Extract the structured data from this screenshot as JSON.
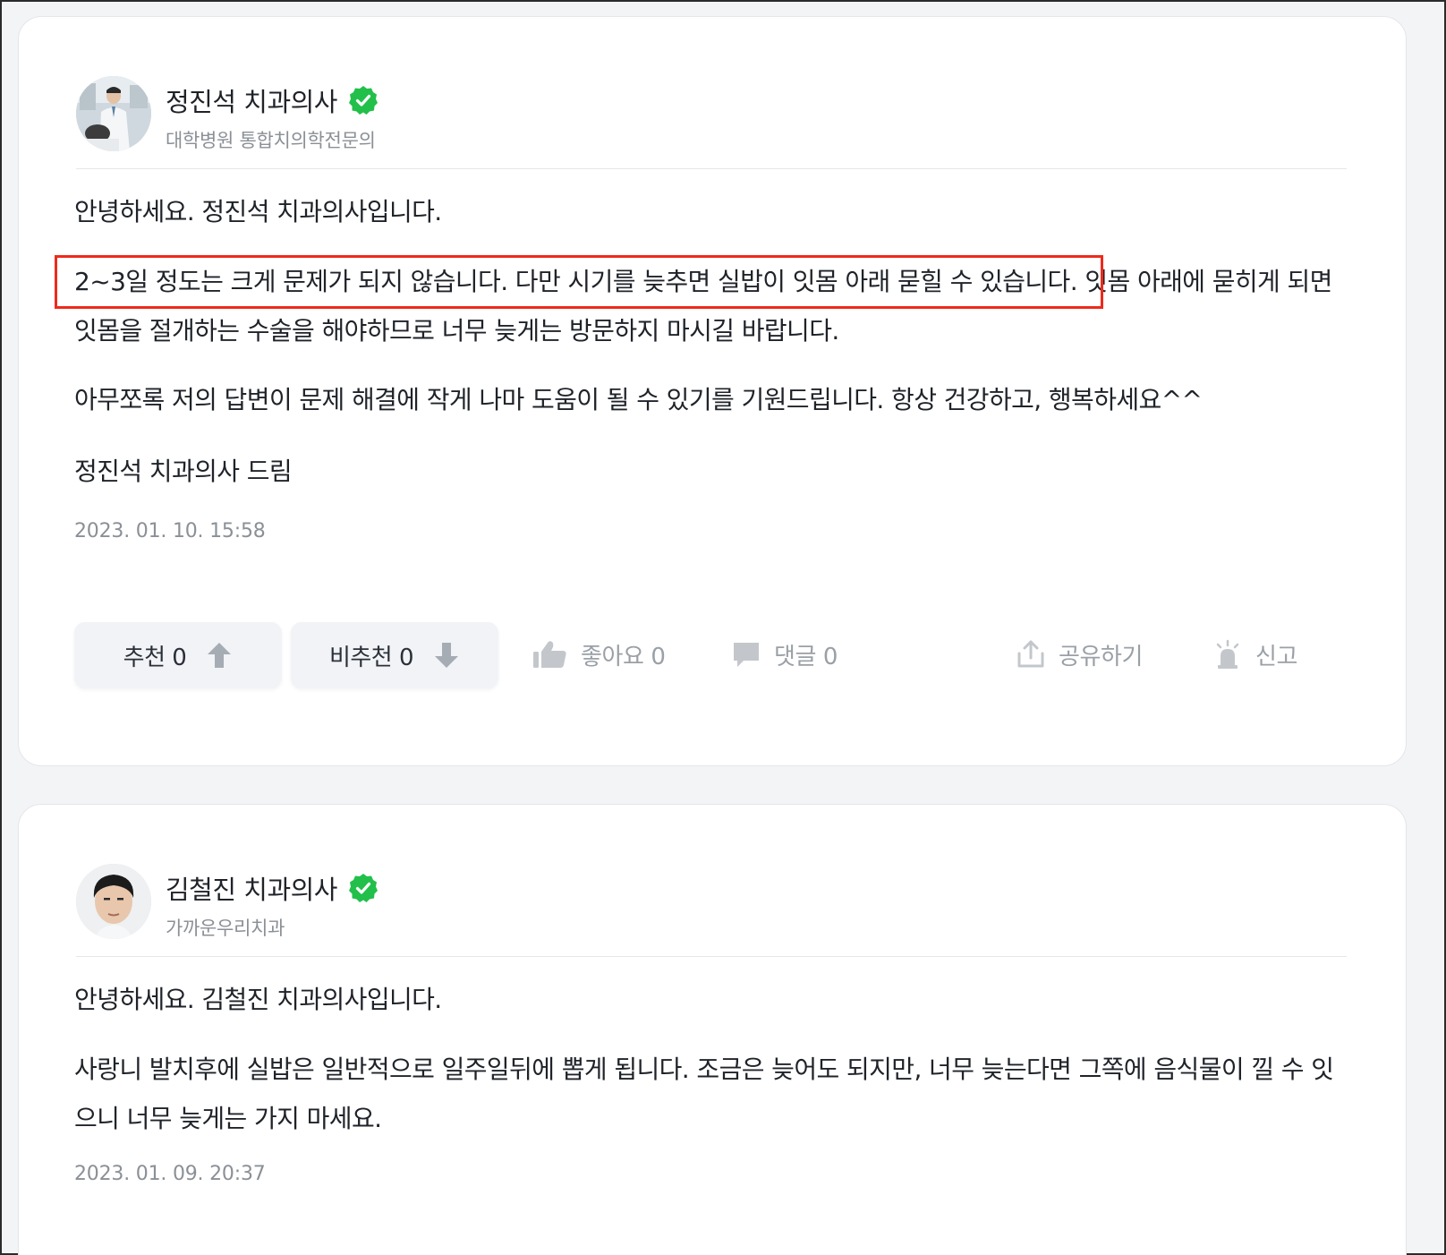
{
  "answers": [
    {
      "author": {
        "name": "정진석 치과의사",
        "affiliation": "대학병원 통합치의학전문의",
        "avatar_icon": "doctor-photo",
        "verified_icon": "verified-check-icon"
      },
      "paragraphs": [
        "안녕하세요. 정진석 치과의사입니다.",
        "2~3일 정도는 크게 문제가 되지 않습니다. 다만 시기를 늦추면 실밥이 잇몸 아래 묻힐 수 있습니다. 잇몸 아래에 묻히게 되면 잇몸을 절개하는 수술을 해야하므로 너무 늦게는 방문하지 마시길 바랍니다.",
        "아무쪼록 저의 답변이 문제 해결에 작게 나마 도움이 될 수 있기를 기원드립니다. 항상 건강하고, 행복하세요^^",
        "정진석 치과의사 드림"
      ],
      "date": "2023. 01. 10. 15:58",
      "actions": {
        "upvote": "추천 0",
        "downvote": "비추천 0",
        "like": "좋아요 0",
        "comment": "댓글 0",
        "share": "공유하기",
        "report": "신고"
      }
    },
    {
      "author": {
        "name": "김철진 치과의사",
        "affiliation": "가까운우리치과",
        "avatar_icon": "doctor-photo",
        "verified_icon": "verified-check-icon"
      },
      "paragraphs": [
        "안녕하세요. 김철진 치과의사입니다.",
        "사랑니 발치후에 실밥은 일반적으로 일주일뒤에 뽑게 됩니다. 조금은 늦어도 되지만, 너무 늦는다면 그쪽에 음식물이 낄 수 잇으니 너무 늦게는 가지 마세요."
      ],
      "date": "2023. 01. 09. 20:37"
    }
  ],
  "colors": {
    "verified_green": "#22c04a",
    "highlight_red": "#ee2a1c",
    "muted_text": "#8b9096"
  }
}
